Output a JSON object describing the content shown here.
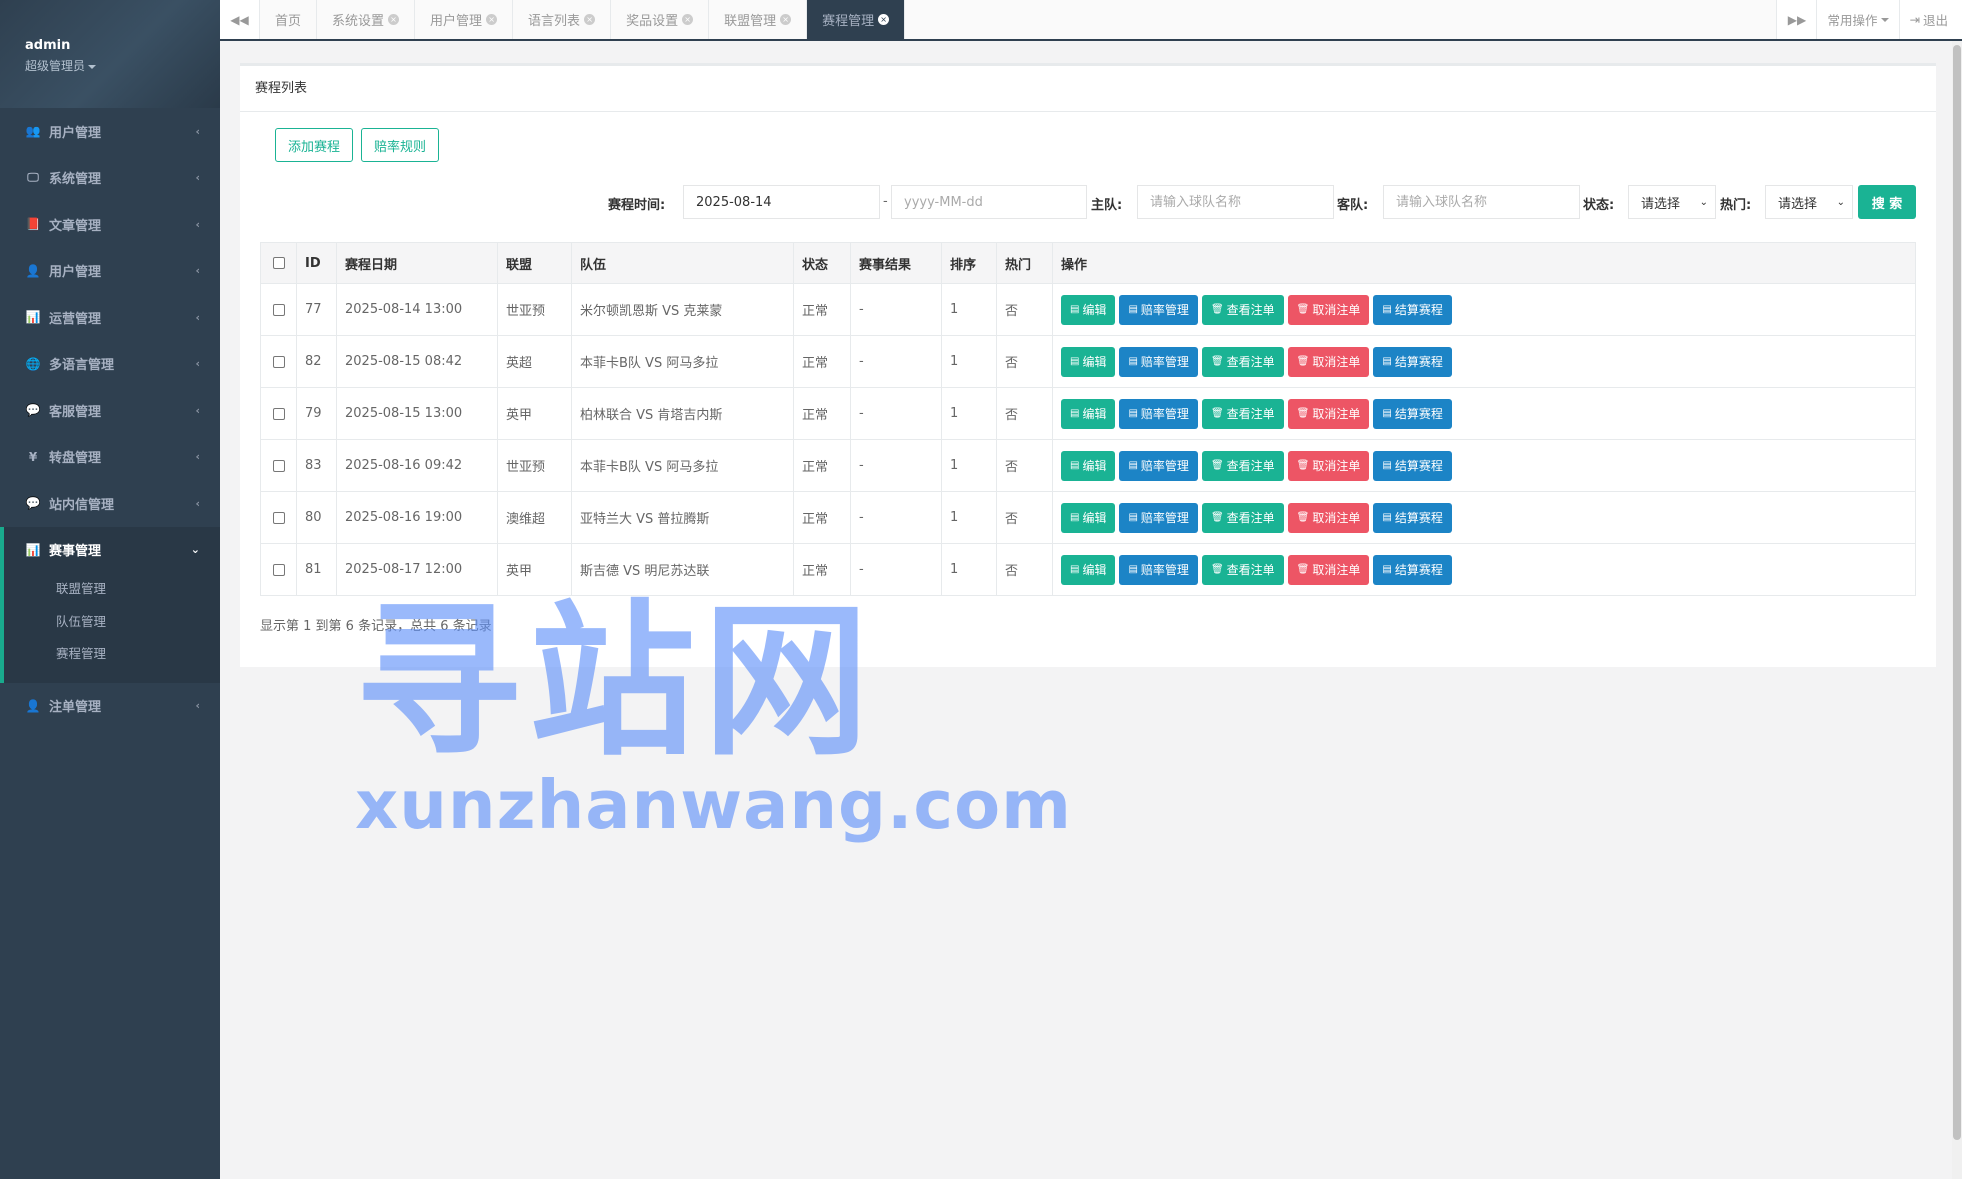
{
  "sidebar": {
    "user": "admin",
    "role": "超级管理员",
    "items": [
      {
        "label": "用户管理",
        "icon": "👥"
      },
      {
        "label": "系统管理",
        "icon": "🖵"
      },
      {
        "label": "文章管理",
        "icon": "📕"
      },
      {
        "label": "用户管理",
        "icon": "👤"
      },
      {
        "label": "运营管理",
        "icon": "📊"
      },
      {
        "label": "多语言管理",
        "icon": "🌐"
      },
      {
        "label": "客服管理",
        "icon": "💬"
      },
      {
        "label": "转盘管理",
        "icon": "¥"
      },
      {
        "label": "站内信管理",
        "icon": "💬"
      }
    ],
    "active_group": {
      "label": "赛事管理",
      "icon": "📊",
      "children": [
        "联盟管理",
        "队伍管理",
        "赛程管理"
      ]
    },
    "last_item": {
      "label": "注单管理",
      "icon": "👤"
    }
  },
  "topbar": {
    "tabs": [
      "首页",
      "系统设置",
      "用户管理",
      "语言列表",
      "奖品设置",
      "联盟管理",
      "赛程管理"
    ],
    "active_tab": "赛程管理",
    "common_ops": "常用操作",
    "logout": "退出"
  },
  "panel": {
    "title": "赛程列表",
    "add_button": "添加赛程",
    "odds_rule_button": "赔率规则"
  },
  "search": {
    "time_label": "赛程时间:",
    "date_from": "2025-08-14",
    "date_sep": "-",
    "date_to_placeholder": "yyyy-MM-dd",
    "home_label": "主队:",
    "home_placeholder": "请输入球队名称",
    "away_label": "客队:",
    "away_placeholder": "请输入球队名称",
    "status_label": "状态:",
    "status_value": "请选择",
    "hot_label": "热门:",
    "hot_value": "请选择",
    "search_button": "搜 索"
  },
  "table": {
    "columns": [
      "ID",
      "赛程日期",
      "联盟",
      "队伍",
      "状态",
      "赛事结果",
      "排序",
      "热门",
      "操作"
    ],
    "rows": [
      {
        "id": "77",
        "date": "2025-08-14 13:00",
        "league": "世亚预",
        "teams": "米尔顿凯恩斯  VS  克莱蒙",
        "status": "正常",
        "result": "-",
        "sort": "1",
        "hot": "否"
      },
      {
        "id": "82",
        "date": "2025-08-15 08:42",
        "league": "英超",
        "teams": "本菲卡B队  VS  阿马多拉",
        "status": "正常",
        "result": "-",
        "sort": "1",
        "hot": "否"
      },
      {
        "id": "79",
        "date": "2025-08-15 13:00",
        "league": "英甲",
        "teams": "柏林联合  VS  肯塔吉内斯",
        "status": "正常",
        "result": "-",
        "sort": "1",
        "hot": "否"
      },
      {
        "id": "83",
        "date": "2025-08-16 09:42",
        "league": "世亚预",
        "teams": "本菲卡B队  VS  阿马多拉",
        "status": "正常",
        "result": "-",
        "sort": "1",
        "hot": "否"
      },
      {
        "id": "80",
        "date": "2025-08-16 19:00",
        "league": "澳维超",
        "teams": "亚特兰大  VS  普拉腾斯",
        "status": "正常",
        "result": "-",
        "sort": "1",
        "hot": "否"
      },
      {
        "id": "81",
        "date": "2025-08-17 12:00",
        "league": "英甲",
        "teams": "斯吉德  VS  明尼苏达联",
        "status": "正常",
        "result": "-",
        "sort": "1",
        "hot": "否"
      }
    ],
    "actions": [
      {
        "label": "编辑",
        "color": "green",
        "icon": "▤"
      },
      {
        "label": "赔率管理",
        "color": "blue",
        "icon": "▤"
      },
      {
        "label": "查看注单",
        "color": "green",
        "icon": "🗑"
      },
      {
        "label": "取消注单",
        "color": "red",
        "icon": "🗑"
      },
      {
        "label": "结算赛程",
        "color": "blue",
        "icon": "▤"
      }
    ]
  },
  "pager": "显示第 1 到第 6 条记录，总共 6 条记录",
  "watermark": {
    "cn": "寻站网",
    "en": "xunzhanwang.com"
  }
}
